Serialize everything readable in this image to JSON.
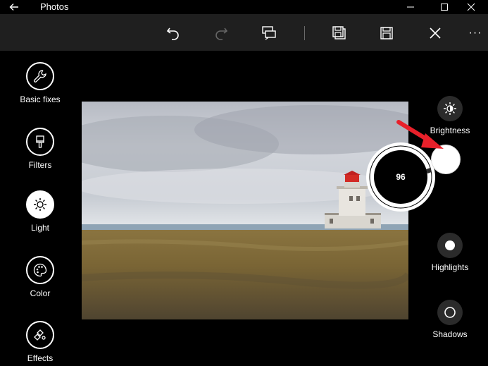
{
  "window": {
    "title": "Photos"
  },
  "toolbar": {
    "buttons": [
      "undo-icon",
      "redo-icon",
      "compare-icon",
      "save-copy-icon",
      "save-icon",
      "close-icon",
      "more-icon"
    ],
    "more_label": "···"
  },
  "left_rail": {
    "items": [
      {
        "label": "Basic fixes",
        "icon": "wrench-icon",
        "active": false
      },
      {
        "label": "Filters",
        "icon": "brush-icon",
        "active": false
      },
      {
        "label": "Light",
        "icon": "sun-icon",
        "active": true
      },
      {
        "label": "Color",
        "icon": "palette-icon",
        "active": false
      },
      {
        "label": "Effects",
        "icon": "effects-icon",
        "active": false
      }
    ]
  },
  "adjustments": {
    "brightness": {
      "label": "Brightness",
      "icon": "brightness-icon"
    },
    "dial_value": "96",
    "highlights": {
      "label": "Highlights",
      "icon": "highlights-icon"
    },
    "shadows": {
      "label": "Shadows",
      "icon": "shadows-icon"
    }
  },
  "colors": {
    "background": "#000000",
    "toolbar": "#1f1f1f",
    "accent_arrow": "#e8202a",
    "active_rail": "#ffffff"
  }
}
